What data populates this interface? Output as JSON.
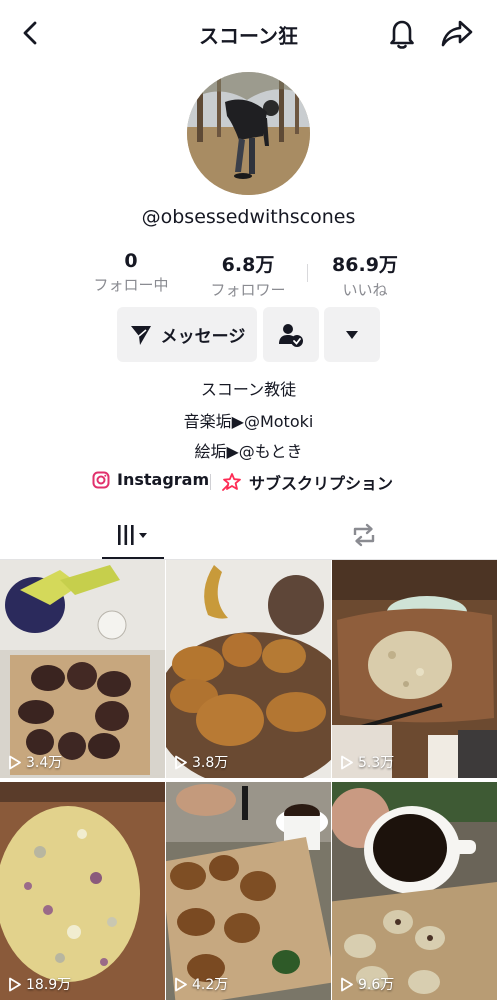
{
  "header": {
    "title": "スコーン狂",
    "back_icon": "chevron-left-icon",
    "bell_icon": "bell-icon",
    "share_icon": "share-icon"
  },
  "profile": {
    "username": "@obsessedwithscones",
    "stats": [
      {
        "value": "0",
        "label": "フォロー中"
      },
      {
        "value": "6.8万",
        "label": "フォロワー"
      },
      {
        "value": "86.9万",
        "label": "いいね"
      }
    ],
    "message_label": "メッセージ",
    "bio": [
      "スコーン教徒",
      "音楽垢▶@Motoki",
      "絵垢▶@もとき"
    ],
    "links": {
      "instagram": "Instagram",
      "subscription": "サブスクリプション"
    }
  },
  "tabs": {
    "videos_icon": "grid-icon",
    "repost_icon": "repost-icon"
  },
  "videos": [
    {
      "views": "3.4万"
    },
    {
      "views": "3.8万"
    },
    {
      "views": "5.3万"
    },
    {
      "views": "18.9万"
    },
    {
      "views": "4.2万"
    },
    {
      "views": "9.6万"
    }
  ],
  "colors": {
    "text": "#161823",
    "muted": "#8a8b91",
    "button_bg": "#f1f1f2",
    "instagram": "#e1306c",
    "subscription": "#fe2c55"
  }
}
